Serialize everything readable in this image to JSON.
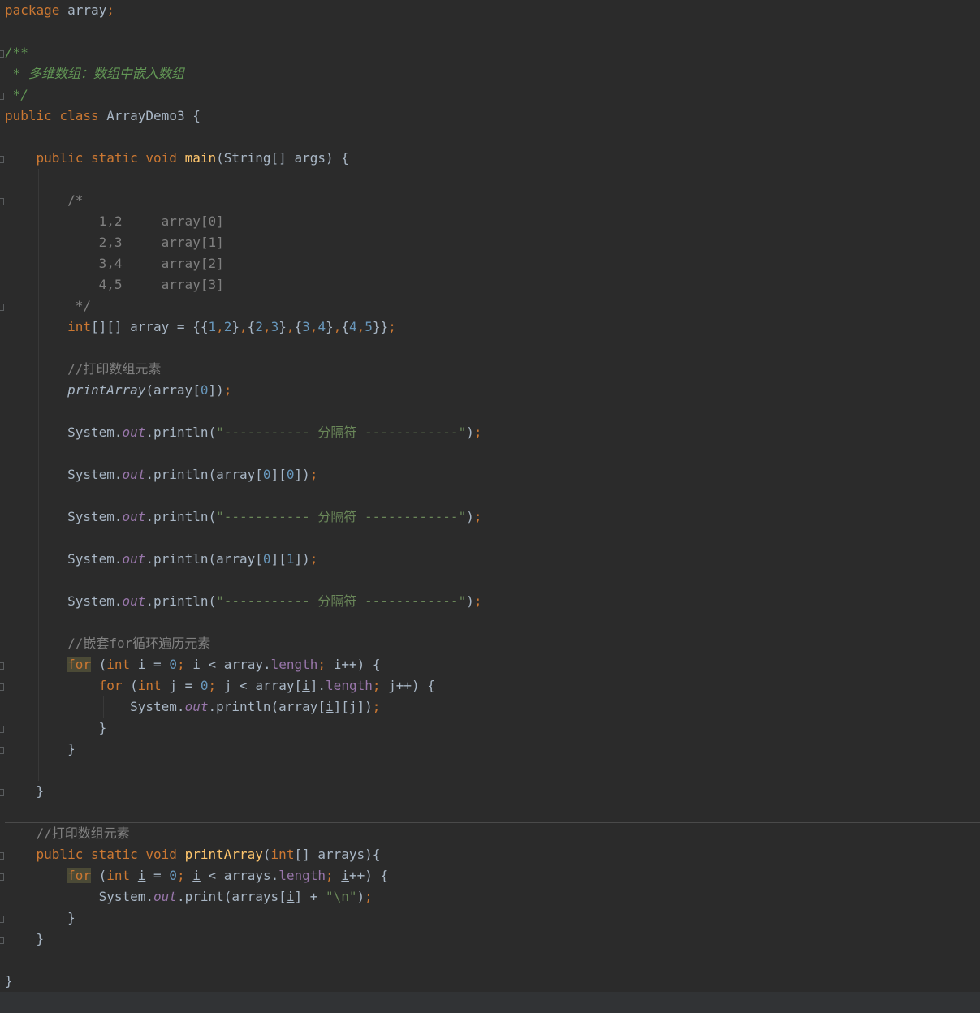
{
  "code": {
    "pkg_keyword": "package",
    "pkg_name": " array",
    "semicolon": ";",
    "doc_open": "/**",
    "doc_text": " * 多维数组：数组中嵌入数组",
    "doc_close": " */",
    "kw_public": "public",
    "kw_class": "class",
    "kw_static": "static",
    "kw_void": "void",
    "kw_int": "int",
    "kw_for": "for",
    "class_name": "ArrayDemo3",
    "main_name": "main",
    "main_params": "(String[] args) {",
    "block_open": "/*",
    "block_lines": [
      "    1,2     array[0]",
      "    2,3     array[1]",
      "    3,4     array[2]",
      "    4,5     array[3]"
    ],
    "block_close": " */",
    "array_decl": "[][] array = {{",
    "nums": [
      "0",
      "1",
      "2",
      "3",
      "4",
      "5"
    ],
    "comment_print": "//打印数组元素",
    "call_print_array": "printArray",
    "arg_array": "(array[",
    "system": "System.",
    "out": "out",
    "println": ".println(",
    "print": ".print(",
    "separator_str": "\"----------- 分隔符 ------------\"",
    "comment_nested": "//嵌套for循环遍历元素",
    "var_i": "i",
    "var_j": "j",
    "length": "length",
    "array_word": "array",
    "arrays_word": "arrays",
    "newline_str": "\"\\n\"",
    "method_print_array": "printArray",
    "close_brace": "}"
  }
}
